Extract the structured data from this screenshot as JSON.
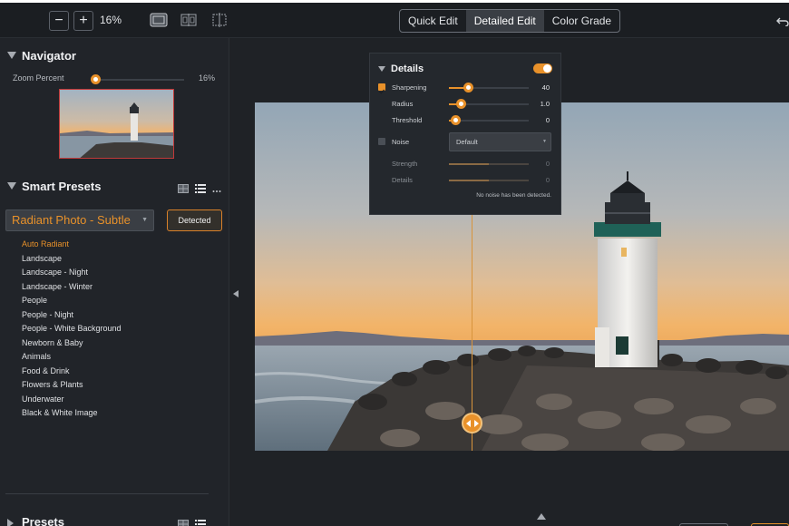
{
  "toolbar": {
    "zoom_out_label": "−",
    "zoom_in_label": "+",
    "zoom_value": "16%",
    "tabs": [
      {
        "label": "Quick Edit",
        "active": false
      },
      {
        "label": "Detailed Edit",
        "active": true
      },
      {
        "label": "Color Grade",
        "active": false
      }
    ]
  },
  "navigator": {
    "title": "Navigator",
    "zoom_label": "Zoom Percent",
    "zoom_value": "16%",
    "zoom_level": 0.16
  },
  "smart_presets": {
    "title": "Smart Presets",
    "selected": "Radiant Photo - Subtle",
    "detected_button": "Detected",
    "items": [
      {
        "label": "Auto Radiant",
        "active": true
      },
      {
        "label": "Landscape"
      },
      {
        "label": "Landscape - Night"
      },
      {
        "label": "Landscape - Winter"
      },
      {
        "label": "People"
      },
      {
        "label": "People - Night"
      },
      {
        "label": "People - White Background"
      },
      {
        "label": "Newborn & Baby"
      },
      {
        "label": "Animals"
      },
      {
        "label": "Food & Drink"
      },
      {
        "label": "Flowers & Plants"
      },
      {
        "label": "Underwater"
      },
      {
        "label": "Black & White Image"
      }
    ]
  },
  "presets": {
    "title": "Presets"
  },
  "details": {
    "title": "Details",
    "enabled": true,
    "sharpening": {
      "label": "Sharpening",
      "value": "40",
      "checked": true,
      "level": 0.4
    },
    "radius": {
      "label": "Radius",
      "value": "1.0",
      "level": 0.15
    },
    "threshold": {
      "label": "Threshold",
      "value": "0",
      "level": 0.08
    },
    "noise": {
      "label": "Noise",
      "checked": false,
      "mode": "Default"
    },
    "strength": {
      "label": "Strength",
      "value": "0",
      "level": 0.5
    },
    "details_slider": {
      "label": "Details",
      "value": "0",
      "level": 0.5
    },
    "note": "No noise has been detected."
  },
  "colors": {
    "accent": "#e8912a",
    "background": "#1f2226",
    "panel": "#24282d"
  }
}
